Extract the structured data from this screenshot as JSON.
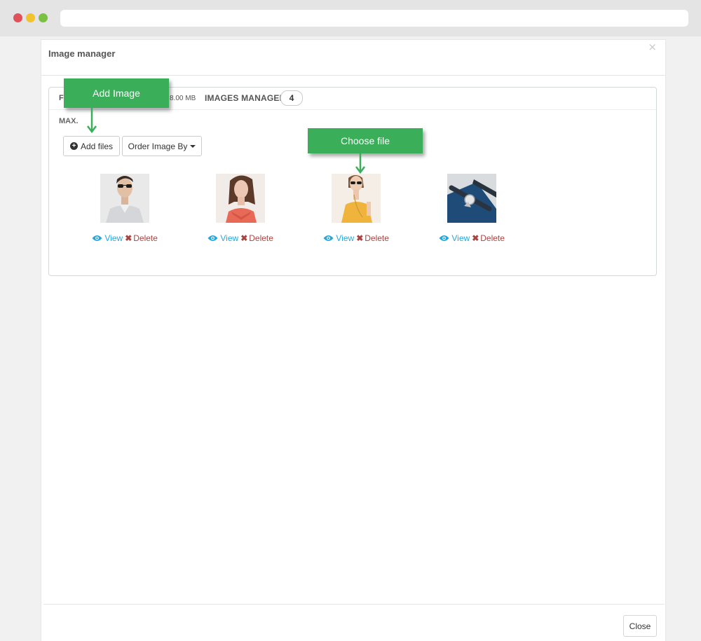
{
  "modal": {
    "title": "Image manager",
    "close_x": "×",
    "close_button": "Close"
  },
  "panel": {
    "heading_prefix": "FO",
    "max_size": "8.00 MB",
    "manager_label": "IMAGES MANAGER",
    "image_count": "4",
    "max_label": "MAX."
  },
  "toolbar": {
    "add_files_label": "Add files",
    "order_label": "Order Image By"
  },
  "images": [
    {
      "view": "View",
      "delete": "Delete"
    },
    {
      "view": "View",
      "delete": "Delete"
    },
    {
      "view": "View",
      "delete": "Delete"
    },
    {
      "view": "View",
      "delete": "Delete"
    }
  ],
  "annotations": {
    "add_image": "Add Image",
    "choose_file": "Choose file",
    "color": "#3bae5a"
  },
  "colors": {
    "link": "#25a7de",
    "delete": "#a94442"
  }
}
